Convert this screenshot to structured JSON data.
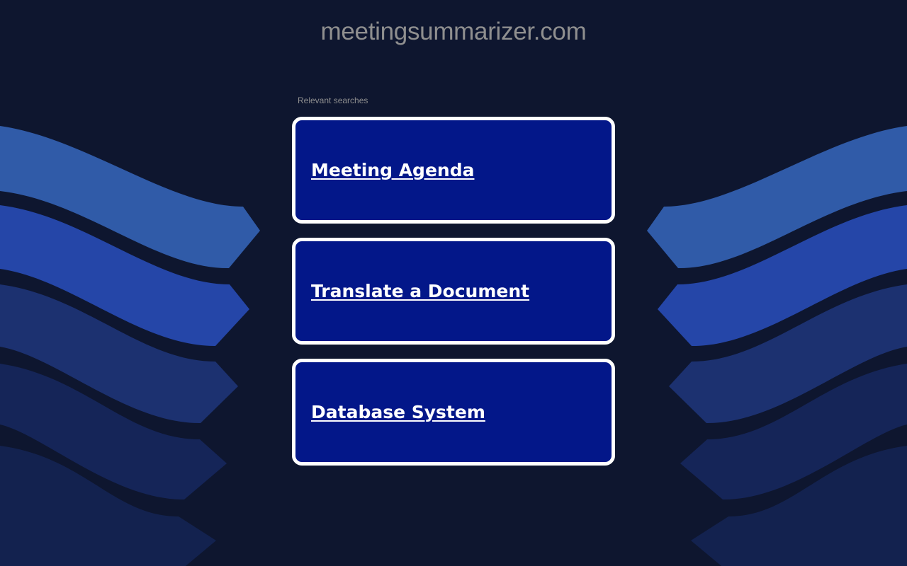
{
  "header": {
    "domain": "meetingsummarizer.com"
  },
  "main": {
    "relevant_label": "Relevant searches",
    "searches": [
      {
        "label": "Meeting Agenda"
      },
      {
        "label": "Translate a Document"
      },
      {
        "label": "Database System"
      }
    ]
  },
  "colors": {
    "background": "#0e162f",
    "card_background": "#031789",
    "card_border": "#ffffff",
    "title_text": "#8f8f8f",
    "wave_light": "#305ba8",
    "wave_bright": "#2546a8",
    "wave_mid": "#1c3170",
    "wave_dark": "#152558",
    "wave_darker": "#13224f"
  }
}
